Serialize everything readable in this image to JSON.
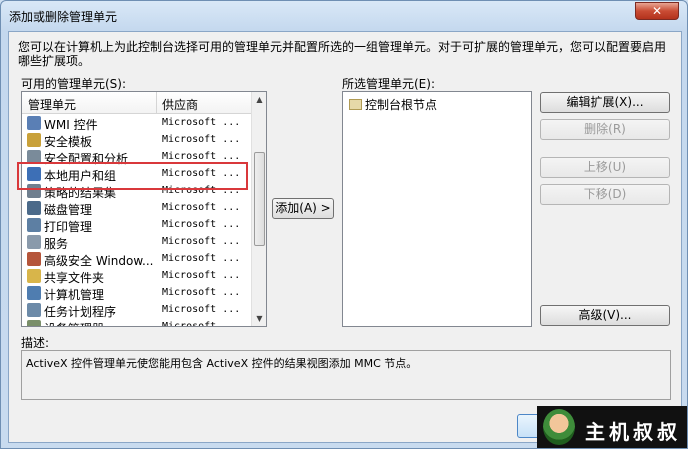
{
  "window": {
    "title": "添加或删除管理单元",
    "close_label": "✕"
  },
  "intro_text": "您可以在计算机上为此控制台选择可用的管理单元并配置所选的一组管理单元。对于可扩展的管理单元，您可以配置要启用哪些扩展项。",
  "available": {
    "label": "可用的管理单元(S):",
    "col_name": "管理单元",
    "col_vendor": "供应商",
    "rows": [
      {
        "name": "WMI 控件",
        "vendor": "Microsoft ...",
        "icon_color": "#5a7fb5"
      },
      {
        "name": "安全模板",
        "vendor": "Microsoft ...",
        "icon_color": "#c9a13a"
      },
      {
        "name": "安全配置和分析",
        "vendor": "Microsoft ...",
        "icon_color": "#7a8b9a"
      },
      {
        "name": "本地用户和组",
        "vendor": "Microsoft ...",
        "icon_color": "#3d6fb6"
      },
      {
        "name": "策略的结果集",
        "vendor": "Microsoft ...",
        "icon_color": "#6f7f8f"
      },
      {
        "name": "磁盘管理",
        "vendor": "Microsoft ...",
        "icon_color": "#4b6a8a"
      },
      {
        "name": "打印管理",
        "vendor": "Microsoft ...",
        "icon_color": "#5d7fa3"
      },
      {
        "name": "服务",
        "vendor": "Microsoft ...",
        "icon_color": "#8a9aab"
      },
      {
        "name": "高级安全 Window...",
        "vendor": "Microsoft ...",
        "icon_color": "#b5553a"
      },
      {
        "name": "共享文件夹",
        "vendor": "Microsoft ...",
        "icon_color": "#d8b54a"
      },
      {
        "name": "计算机管理",
        "vendor": "Microsoft ...",
        "icon_color": "#4f7db0"
      },
      {
        "name": "任务计划程序",
        "vendor": "Microsoft ...",
        "icon_color": "#6c8aa8"
      },
      {
        "name": "设备管理器",
        "vendor": "Microsoft ...",
        "icon_color": "#7a8f6a"
      }
    ]
  },
  "add_button": "添加(A) >",
  "selected": {
    "label": "所选管理单元(E):",
    "root_node": "控制台根节点"
  },
  "right_buttons": {
    "edit_extensions": "编辑扩展(X)...",
    "remove": "删除(R)",
    "move_up": "上移(U)",
    "move_down": "下移(D)",
    "advanced": "高级(V)..."
  },
  "description": {
    "label": "描述:",
    "text": "ActiveX 控件管理单元使您能用包含 ActiveX 控件的结果视图添加 MMC 节点。"
  },
  "watermark": {
    "text": "主机叔叔"
  }
}
